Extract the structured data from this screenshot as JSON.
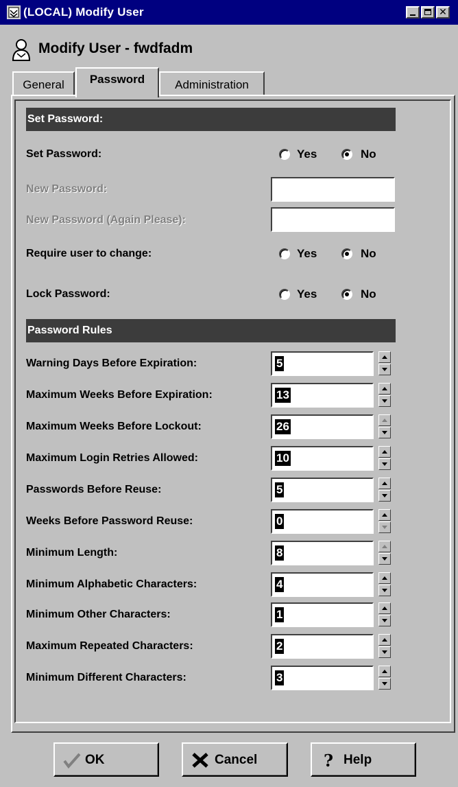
{
  "window": {
    "title": "(LOCAL) Modify User"
  },
  "header": {
    "title": "Modify User - fwdfadm"
  },
  "tabs": [
    {
      "label": "General"
    },
    {
      "label": "Password",
      "active": true
    },
    {
      "label": "Administration"
    }
  ],
  "set_password_section": {
    "heading": "Set Password:",
    "set_password": {
      "label": "Set Password:",
      "yes": "Yes",
      "no": "No",
      "selected": "No"
    },
    "new_password": {
      "label": "New Password:",
      "value": ""
    },
    "new_password_again": {
      "label": "New Password (Again Please):",
      "value": ""
    },
    "require_change": {
      "label": "Require user to change:",
      "yes": "Yes",
      "no": "No",
      "selected": "No"
    },
    "lock_password": {
      "label": "Lock Password:",
      "yes": "Yes",
      "no": "No",
      "selected": "No"
    }
  },
  "rules_section": {
    "heading": "Password Rules",
    "rules": [
      {
        "label": "Warning Days Before Expiration:",
        "value": "5"
      },
      {
        "label": "Maximum Weeks Before Expiration:",
        "value": "13"
      },
      {
        "label": "Maximum Weeks Before Lockout:",
        "value": "26"
      },
      {
        "label": "Maximum Login Retries Allowed:",
        "value": "10"
      },
      {
        "label": "Passwords Before Reuse:",
        "value": "5"
      },
      {
        "label": "Weeks Before Password Reuse:",
        "value": "0"
      },
      {
        "label": "Minimum Length:",
        "value": "8"
      },
      {
        "label": "Minimum Alphabetic Characters:",
        "value": "4"
      },
      {
        "label": "Minimum Other Characters:",
        "value": "1"
      },
      {
        "label": "Maximum Repeated Characters:",
        "value": "2"
      },
      {
        "label": "Minimum Different Characters:",
        "value": "3"
      }
    ]
  },
  "buttons": {
    "ok": "OK",
    "cancel": "Cancel",
    "help": "Help"
  },
  "colors": {
    "titlebar": "#000080",
    "section_bar": "#3c3c3c",
    "face": "#c0c0c0"
  }
}
